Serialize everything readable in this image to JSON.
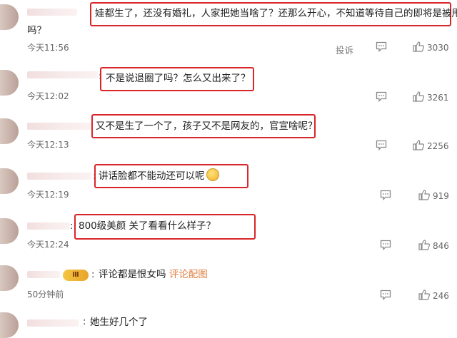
{
  "comments": [
    {
      "text_line1": "娃都生了，还没有婚礼，人家把她当啥了？还那么开心，不知道等待自己的即将是被甩",
      "text_line2": "吗？",
      "time": "今天11:56",
      "report_label": "投诉",
      "likes": "3030"
    },
    {
      "text": "不是说退圈了吗？怎么又出来了？",
      "time": "今天12:02",
      "likes": "3261"
    },
    {
      "text": "又不是生了一个了，孩子又不是网友的，官宣啥呢？",
      "time": "今天12:13",
      "likes": "2256"
    },
    {
      "text": "讲话脸都不能动还可以呢",
      "time": "今天12:19",
      "likes": "919"
    },
    {
      "text": "800级美颜 关了看看什么样子？",
      "time": "今天12:24",
      "likes": "846"
    },
    {
      "text": "评论都是恨女吗",
      "pic_link": "评论配图",
      "badge": "Ⅲ",
      "time": "50分钟前",
      "likes": "246"
    },
    {
      "text": "她生好几个了"
    }
  ],
  "colors": {
    "highlight": "#d9262a",
    "link": "#e07c3e"
  }
}
